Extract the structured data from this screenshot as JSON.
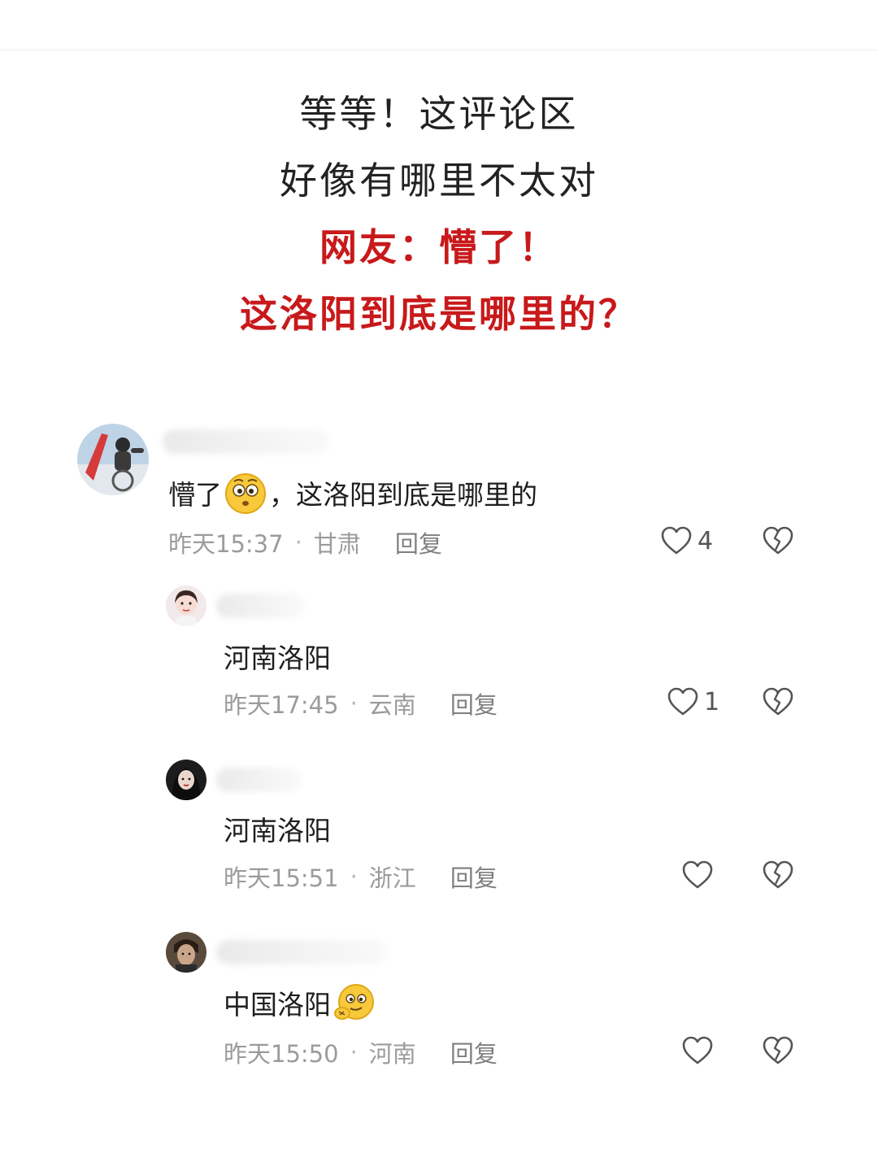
{
  "headline": {
    "line1": "等等！这评论区",
    "line2": "好像有哪里不太对",
    "line3": "网友：懵了！",
    "line4": "这洛阳到底是哪里的？"
  },
  "colors": {
    "accent_red": "#c8191b",
    "text": "#1e1e1e",
    "meta": "#9b9b9b"
  },
  "comments": [
    {
      "text_before": "懵了",
      "emoji": "surprised-face-emoji",
      "text_after": "，这洛阳到底是哪里的",
      "time": "昨天15:37",
      "location": "甘肃",
      "reply_label": "回复",
      "likes": "4",
      "separator": "·"
    },
    {
      "text": "河南洛阳",
      "time": "昨天17:45",
      "location": "云南",
      "reply_label": "回复",
      "likes": "1",
      "separator": "·"
    },
    {
      "text": "河南洛阳",
      "time": "昨天15:51",
      "location": "浙江",
      "reply_label": "回复",
      "likes": "",
      "separator": "·"
    },
    {
      "text": "中国洛阳",
      "emoji": "smirk-face-emoji",
      "time": "昨天15:50",
      "location": "河南",
      "reply_label": "回复",
      "likes": "",
      "separator": "·"
    }
  ]
}
